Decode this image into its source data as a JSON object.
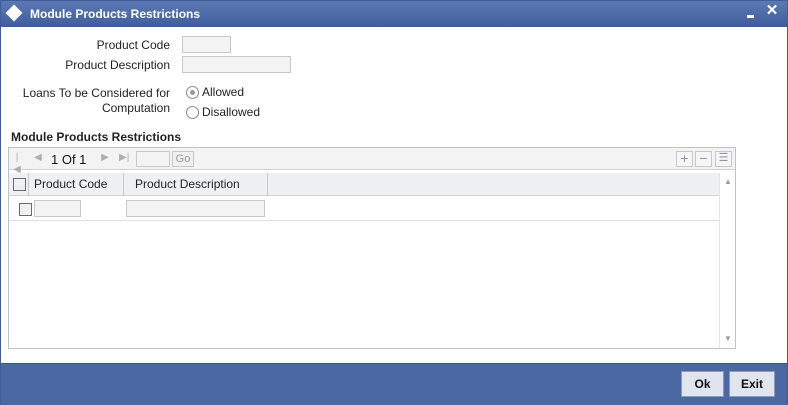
{
  "window": {
    "title": "Module Products Restrictions",
    "minimize_glyph": "",
    "close_glyph": "✕"
  },
  "fields": {
    "product_code_label": "Product Code",
    "product_code_value": "",
    "product_description_label": "Product Description",
    "product_description_value": "",
    "loans_label_line1": "Loans To be Considered for",
    "loans_label_line2": "Computation",
    "radio_allowed": "Allowed",
    "radio_disallowed": "Disallowed",
    "selected_option": "Allowed"
  },
  "section": {
    "title": "Module Products Restrictions"
  },
  "pager": {
    "first_icon": "first-page-icon",
    "prev_icon": "prev-page-icon",
    "next_icon": "next-page-icon",
    "last_icon": "last-page-icon",
    "page_text": "1 Of 1",
    "go_label": "Go",
    "add_glyph": "+",
    "remove_glyph": "−",
    "view_glyph": "☰"
  },
  "grid": {
    "columns": [
      "Product Code",
      "Product Description"
    ],
    "rows": [
      {
        "product_code": "",
        "product_description": ""
      }
    ]
  },
  "footer": {
    "ok_label": "Ok",
    "exit_label": "Exit"
  },
  "colors": {
    "titlebar": "#3e5d9b",
    "footer": "#4b68a3",
    "button_bg": "#dfe4ee"
  }
}
